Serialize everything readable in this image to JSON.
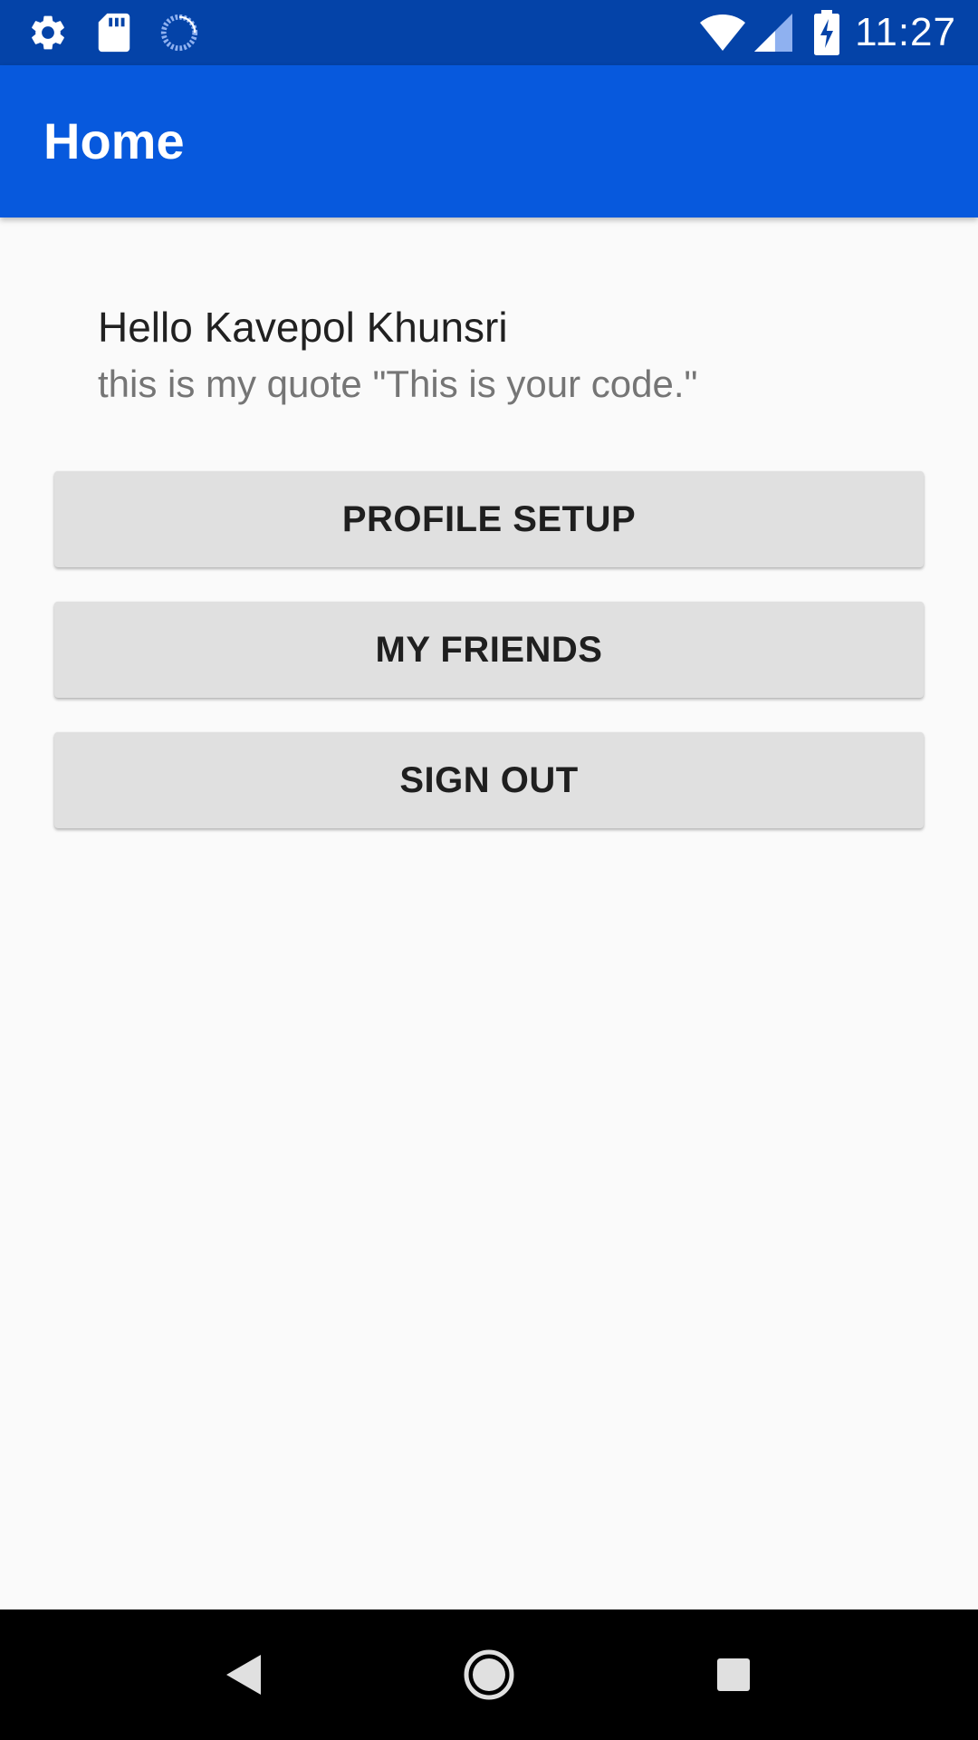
{
  "status_bar": {
    "time": "11:27",
    "left_icons": [
      "gear-icon",
      "sd-card-icon",
      "sync-progress-icon"
    ],
    "right_icons": [
      "wifi-icon",
      "cell-signal-icon",
      "battery-charging-icon"
    ],
    "color": "#0443a8"
  },
  "app_bar": {
    "title": "Home",
    "color": "#0759dd"
  },
  "profile": {
    "greeting": "Hello Kavepol Khunsri",
    "quote": "this is my quote \"This is your code.\""
  },
  "buttons": {
    "profile_setup": "PROFILE SETUP",
    "my_friends": "MY FRIENDS",
    "sign_out": "SIGN OUT"
  },
  "nav_bar": {
    "icons": [
      "back-icon",
      "home-icon",
      "recents-icon"
    ]
  }
}
